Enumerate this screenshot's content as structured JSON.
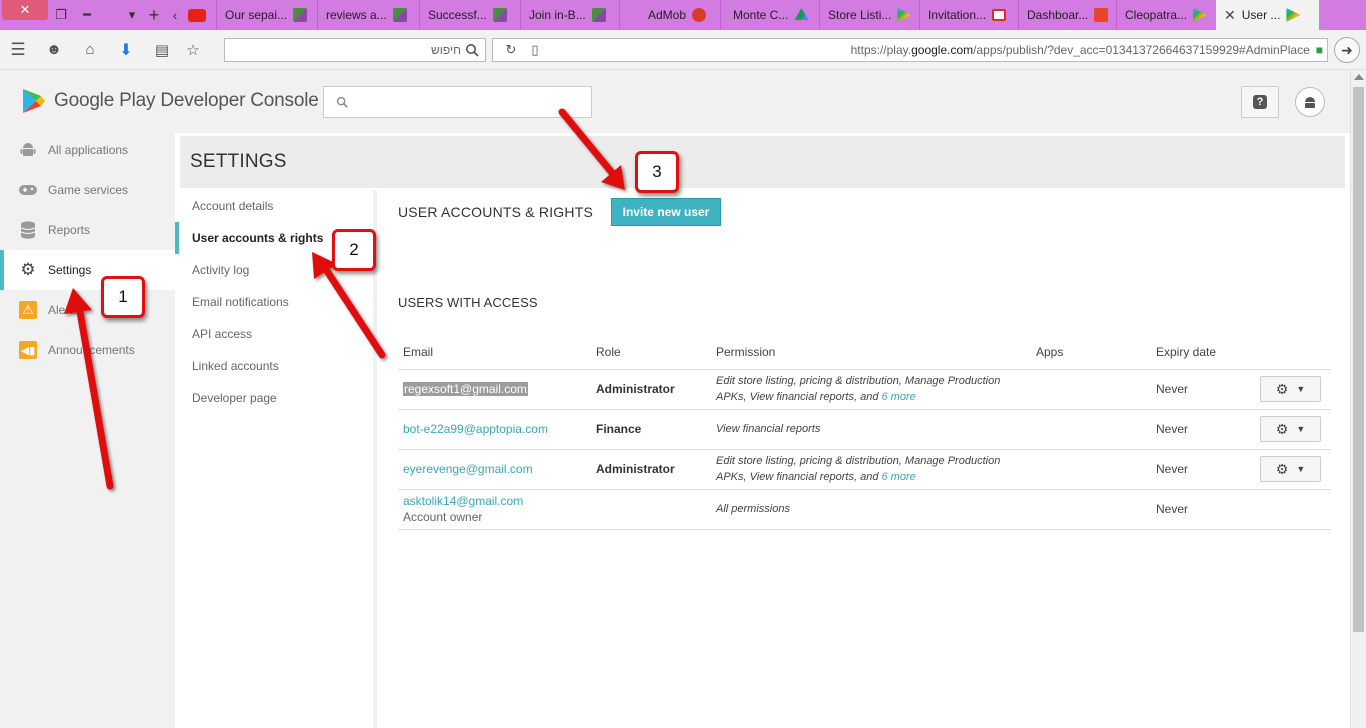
{
  "browser": {
    "tabs": [
      {
        "label": "",
        "icon": "youtube-icon",
        "color": "#e62117"
      },
      {
        "label": "Our sepai...",
        "icon": "cube-icon",
        "color": "#4a8f3f"
      },
      {
        "label": "reviews a...",
        "icon": "cube-icon",
        "color": "#4a8f3f"
      },
      {
        "label": "Successf...",
        "icon": "cube-icon",
        "color": "#4a8f3f"
      },
      {
        "label": "Join in-B...",
        "icon": "cube-icon",
        "color": "#4a8f3f"
      },
      {
        "label": "AdMob",
        "icon": "admob-icon",
        "color": "#d93b2b"
      },
      {
        "label": "Monte C...",
        "icon": "drive-icon",
        "color": "#f4b400"
      },
      {
        "label": "Store Listi...",
        "icon": "play-icon",
        "color": "#34a853"
      },
      {
        "label": "Invitation...",
        "icon": "gmail-icon",
        "color": "#d93025"
      },
      {
        "label": "Dashboar...",
        "icon": "app-icon",
        "color": "#e8452b"
      },
      {
        "label": "Cleopatra...",
        "icon": "play-icon",
        "color": "#34a853"
      }
    ],
    "active_tab": {
      "label": "User ...",
      "icon": "play-icon",
      "close": "✕"
    },
    "search_placeholder": "חיפוש",
    "url_prefix": "https://play.",
    "url_host": "google.com",
    "url_path": "/apps/publish/?dev_acc=01341372664637159929#AdminPlace"
  },
  "console": {
    "brand": "Google Play Developer Console",
    "search_placeholder": ""
  },
  "nav": {
    "items": [
      {
        "label": "All applications",
        "icon": "android-icon"
      },
      {
        "label": "Game services",
        "icon": "gamepad-icon"
      },
      {
        "label": "Reports",
        "icon": "database-icon"
      },
      {
        "label": "Settings",
        "icon": "gear-icon"
      },
      {
        "label": "Alerts",
        "icon": "warning-icon"
      },
      {
        "label": "Announcements",
        "icon": "megaphone-icon"
      }
    ]
  },
  "settings": {
    "title": "SETTINGS",
    "subnav": [
      "Account details",
      "User accounts & rights",
      "Activity log",
      "Email notifications",
      "API access",
      "Linked accounts",
      "Developer page"
    ],
    "section_title": "USER ACCOUNTS & RIGHTS",
    "invite_label": "Invite new user",
    "users_title": "USERS WITH ACCESS",
    "columns": [
      "Email",
      "Role",
      "Permission",
      "Apps",
      "Expiry date"
    ],
    "users": [
      {
        "email": "regexsoft1@gmail.com",
        "role": "Administrator",
        "perm": "Edit store listing, pricing & distribution, Manage Production APKs, View financial reports, and ",
        "more": "6 more",
        "apps": "",
        "expiry": "Never"
      },
      {
        "email": "bot-e22a99@apptopia.com",
        "role": "Finance",
        "perm": "View financial reports",
        "more": "",
        "apps": "",
        "expiry": "Never"
      },
      {
        "email": "eyerevenge@gmail.com",
        "role": "Administrator",
        "perm": "Edit store listing, pricing & distribution, Manage Production APKs, View financial reports, and ",
        "more": "6 more",
        "apps": "",
        "expiry": "Never"
      },
      {
        "email": "asktolik14@gmail.com",
        "sub": "Account owner",
        "role": "",
        "perm": "All permissions",
        "more": "",
        "apps": "",
        "expiry": "Never"
      }
    ]
  },
  "annotations": {
    "badge1": "1",
    "badge2": "2",
    "badge3": "3",
    "arrow_color": "#e01010"
  }
}
